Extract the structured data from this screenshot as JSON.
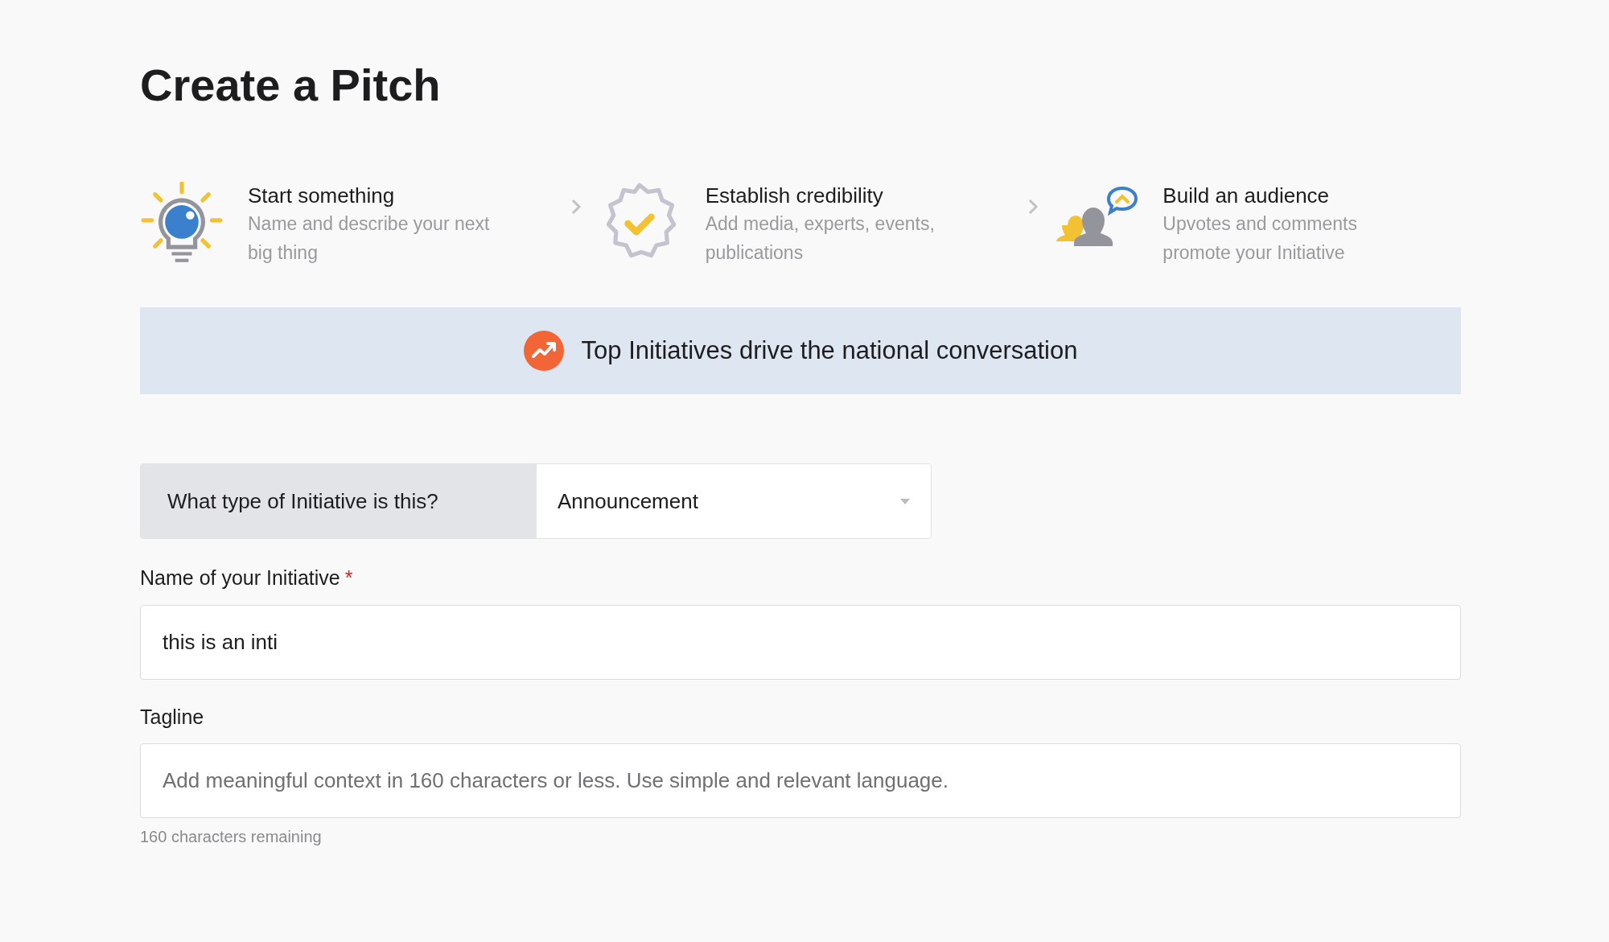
{
  "page_title": "Create a Pitch",
  "steps": [
    {
      "kind": "bulb",
      "title": "Start something",
      "description": "Name and describe your next big thing"
    },
    {
      "kind": "badge",
      "title": "Establish credibility",
      "description": "Add media, experts, events, publications"
    },
    {
      "kind": "audience",
      "title": "Build an audience",
      "description": "Upvotes and comments promote your Initiative"
    }
  ],
  "banner": {
    "text": "Top Initiatives drive the national conversation"
  },
  "type_select": {
    "label": "What type of Initiative is this?",
    "value": "Announcement"
  },
  "fields": [
    {
      "label": "Name of your Initiative",
      "required_mark": "*",
      "value": "this is an inti"
    },
    {
      "label": "Tagline",
      "placeholder": "Add meaningful context in 160 characters or less. Use simple and relevant language.",
      "helper": "160 characters remaining"
    }
  ]
}
